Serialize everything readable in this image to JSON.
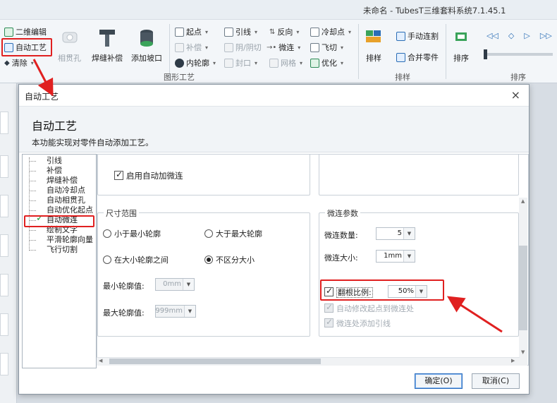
{
  "window": {
    "title": "未命名 - TubesT三维套料系统7.1.45.1"
  },
  "ribbon": {
    "col1": {
      "btn1": "二维编辑",
      "btn2": "自动工艺",
      "btn3": "清除"
    },
    "big": [
      "相贯孔",
      "焊缝补偿",
      "添加坡口"
    ],
    "col2": [
      "起点",
      "补偿",
      "内轮廓"
    ],
    "col3": [
      "引线",
      "阴/阴切",
      "封口"
    ],
    "col4": [
      "反向",
      "微连",
      "网格"
    ],
    "col5": [
      "冷却点",
      "飞切",
      "优化"
    ],
    "sort": {
      "big": "排样",
      "manual": "手动连割",
      "merge": "合并零件",
      "order": "排序"
    },
    "groups": {
      "craft": "图形工艺",
      "layout": "排样",
      "order": "排序"
    },
    "icons": [
      "edit-2d-icon",
      "auto-craft-icon",
      "clear-icon",
      "pipe-hole-icon",
      "weld-icon",
      "bevel-icon",
      "arrow-left-double-icon",
      "arrow-left-icon",
      "arrow-right-icon",
      "arrow-right-double-icon"
    ]
  },
  "dialog": {
    "title": "自动工艺",
    "close": "×",
    "heading": "自动工艺",
    "description": "本功能实现对零件自动添加工艺。",
    "tree": [
      "引线",
      "补偿",
      "焊缝补偿",
      "自动冷却点",
      "自动相贯孔",
      "自动优化起点",
      "自动微连",
      "绘制文字",
      "平滑轮廓向量",
      "飞行切割"
    ],
    "enable_label": "启用自动加微连",
    "size_group": {
      "title": "尺寸范围",
      "opt_less": "小于最小轮廓",
      "opt_greater": "大于最大轮廓",
      "opt_between": "在大小轮廓之间",
      "opt_any": "不区分大小",
      "min_label": "最小轮廓值:",
      "min_value": "0mm",
      "max_label": "最大轮廓值:",
      "max_value": "999mm"
    },
    "param_group": {
      "title": "微连参数",
      "count_label": "微连数量:",
      "count_value": "5",
      "size_label": "微连大小:",
      "size_value": "1mm",
      "ratio_label": "翻根比例:",
      "ratio_value": "50%",
      "auto_start": "自动修改起点到微连处",
      "add_lead": "微连处添加引线"
    },
    "ok": "确定(O)",
    "cancel": "取消(C)"
  },
  "colors": {
    "highlight": "#e02020",
    "check": "#1e9e3a",
    "accent": "#2d6fc0"
  }
}
